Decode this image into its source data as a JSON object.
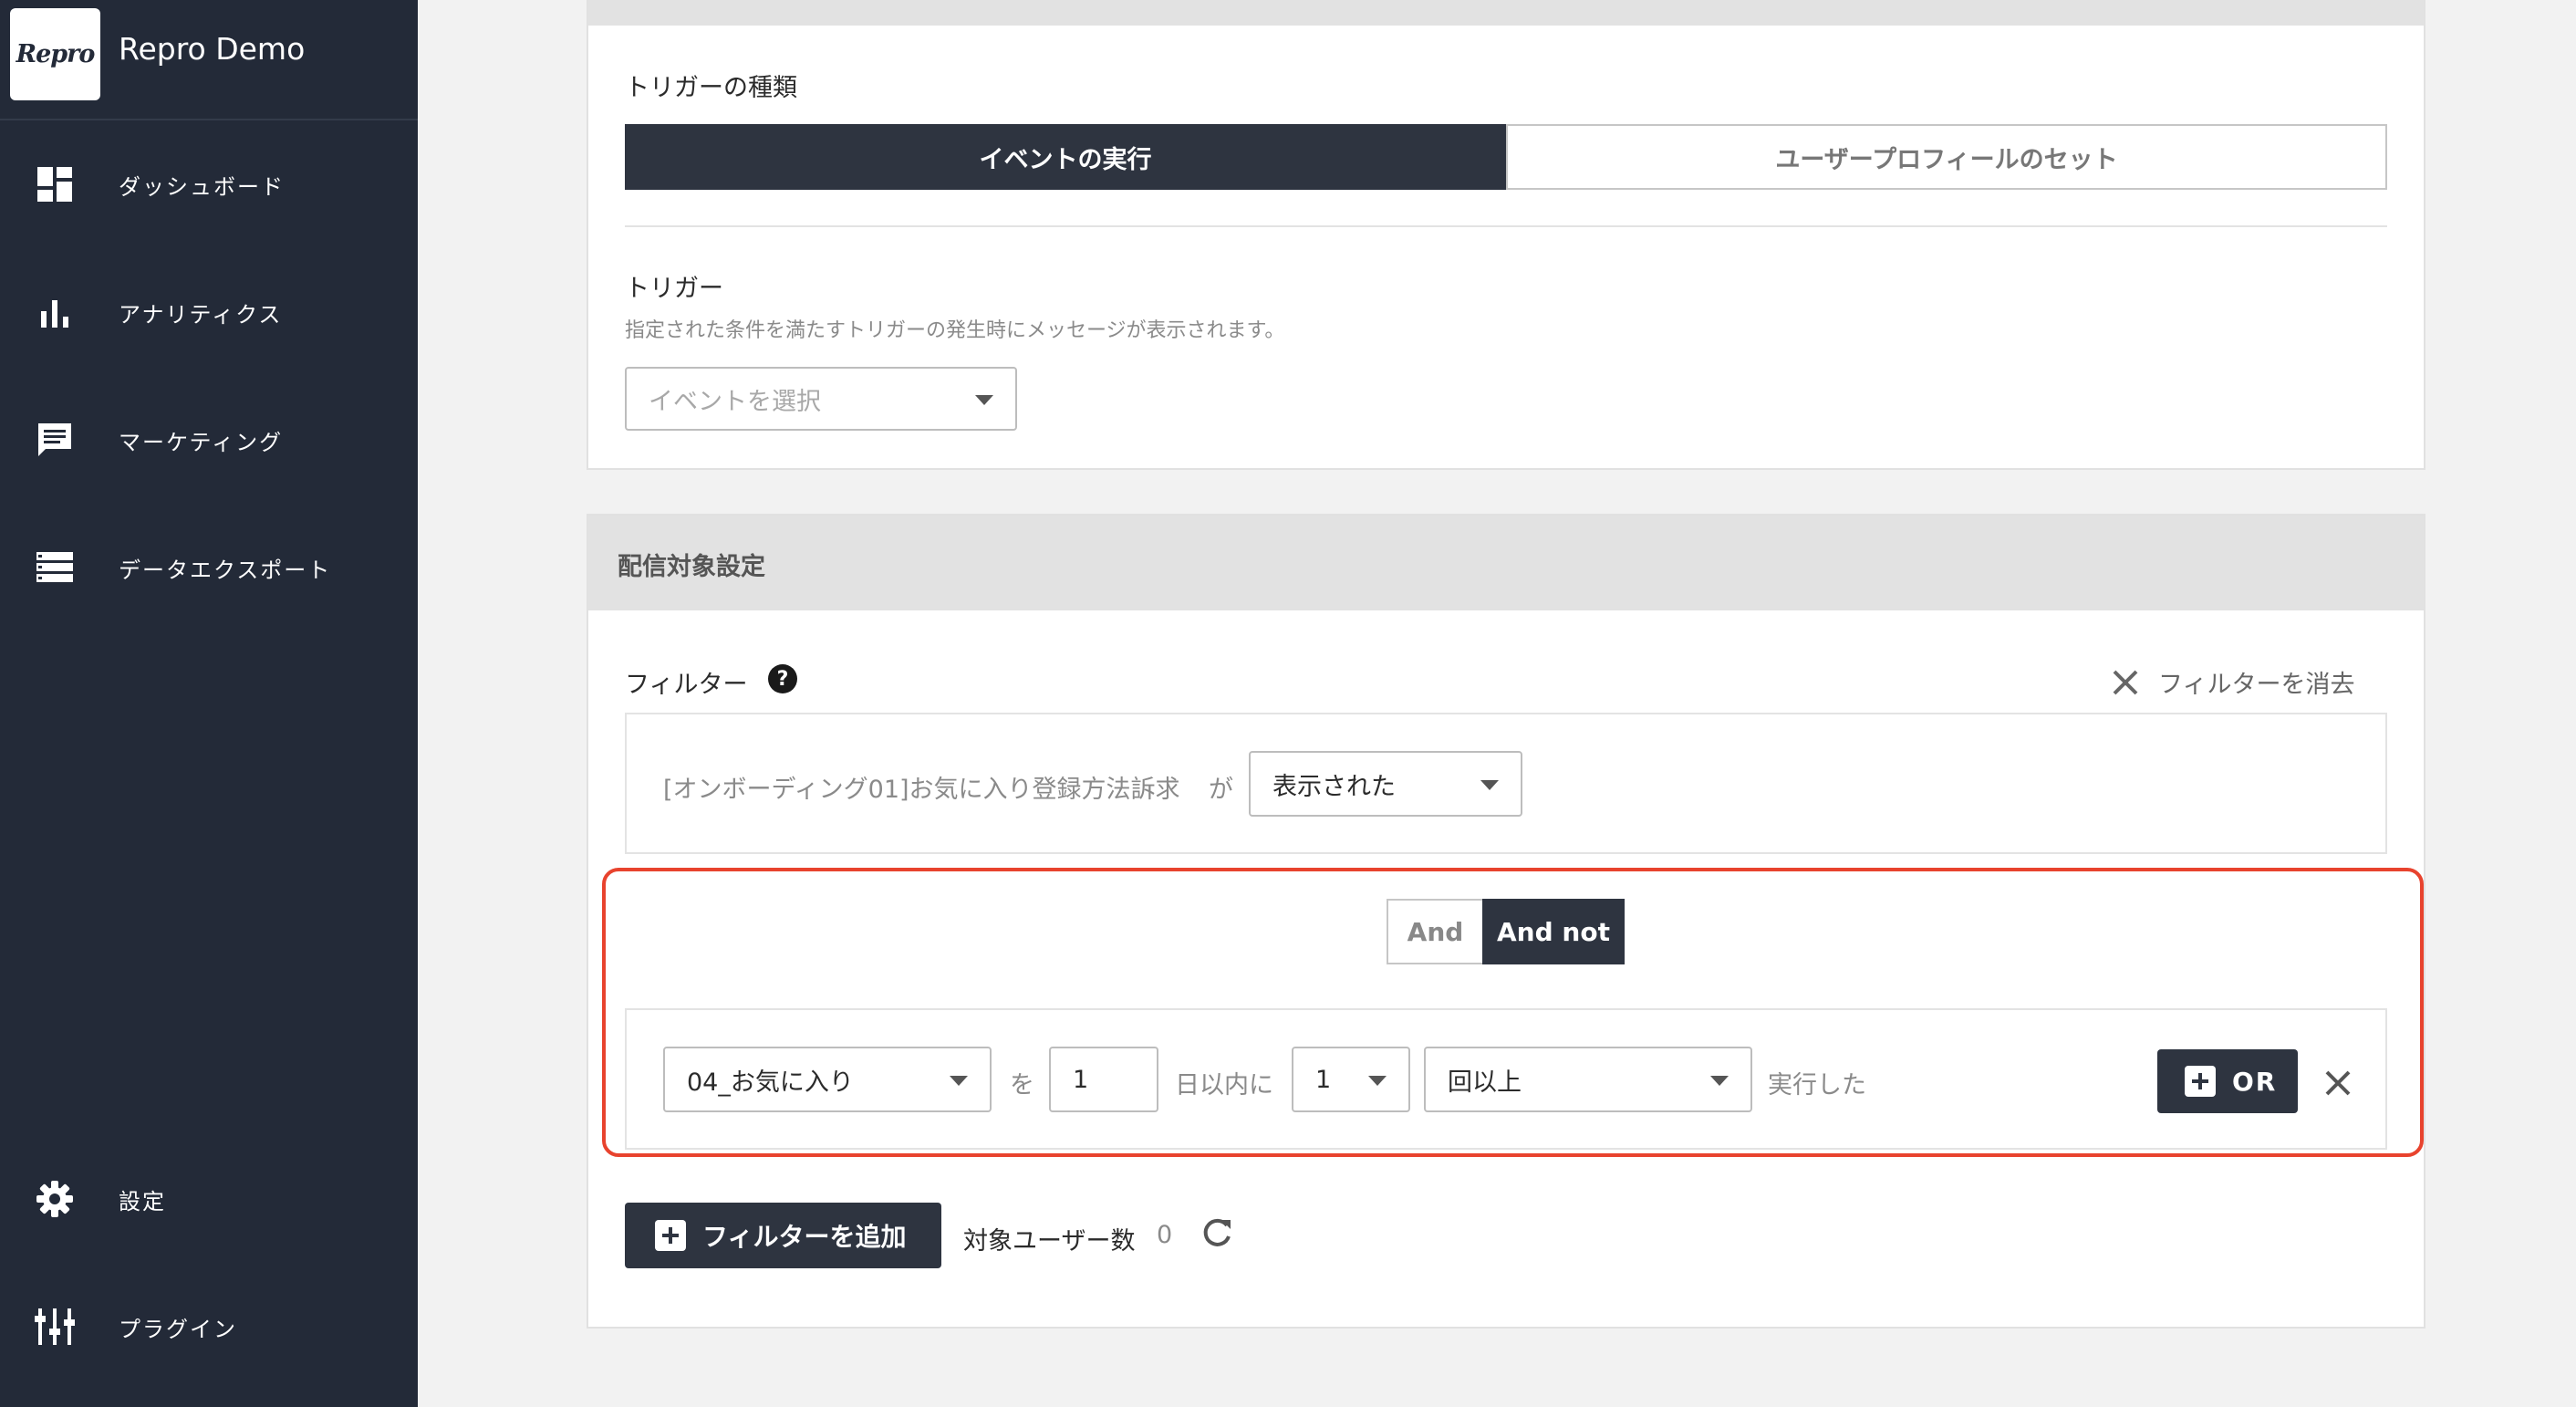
{
  "app": {
    "logo_text": "Repro",
    "title": "Repro Demo"
  },
  "sidebar": {
    "items": [
      {
        "label": "ダッシュボード",
        "icon": "dashboard-icon"
      },
      {
        "label": "アナリティクス",
        "icon": "bar-chart-icon"
      },
      {
        "label": "マーケティング",
        "icon": "message-icon"
      },
      {
        "label": "データエクスポート",
        "icon": "list-icon"
      },
      {
        "label": "設定",
        "icon": "gear-icon"
      },
      {
        "label": "プラグイン",
        "icon": "plugin-sliders-icon"
      }
    ]
  },
  "trigger": {
    "type_label": "トリガーの種類",
    "type_options": [
      "イベントの実行",
      "ユーザープロフィールのセット"
    ],
    "selected_type": "イベントの実行",
    "label": "トリガー",
    "description": "指定された条件を満たすトリガーの発生時にメッセージが表示されます。",
    "event_placeholder": "イベントを選択"
  },
  "targeting": {
    "header": "配信対象設定",
    "filter_label": "フィルター",
    "help_icon": "question-circle-icon",
    "clear_label": "フィルターを消去",
    "first_condition": {
      "subject": "[オンボーディング01]お気に入り登録方法訴求",
      "particle": "が",
      "status": "表示された"
    },
    "combinator": {
      "options": [
        "And",
        "And not"
      ],
      "selected": "And not"
    },
    "second_condition": {
      "event": "04_お気に入り",
      "particle": "を",
      "days": "1",
      "days_suffix": "日以内に",
      "count": "1",
      "comparison": "回以上",
      "action": "実行した",
      "or_label": "OR"
    },
    "add_filter_label": "フィルターを追加",
    "target_users_label": "対象ユーザー数",
    "target_users_count": "0"
  },
  "colors": {
    "sidebar": "#232a38",
    "dark_button": "#2e3440",
    "highlight": "#e8432e"
  }
}
